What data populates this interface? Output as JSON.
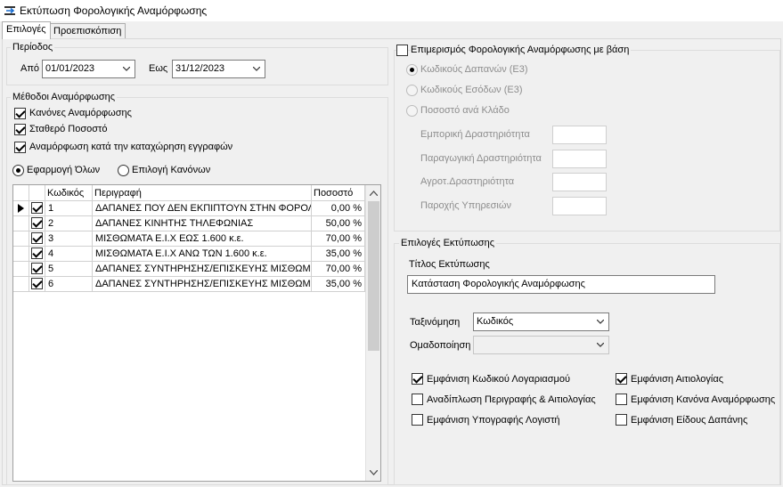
{
  "window": {
    "title": "Εκτύπωση Φορολογικής Αναμόρφωσης"
  },
  "tabs": [
    {
      "label": "Επιλογές"
    },
    {
      "label": "Προεπισκόπιση"
    }
  ],
  "period": {
    "label": "Περίοδος",
    "from_label": "Από",
    "from_value": "01/01/2023",
    "to_label": "Εως",
    "to_value": "31/12/2023"
  },
  "methods": {
    "label": "Μέθοδοι Αναμόρφωσης",
    "checkboxes": [
      {
        "label": "Κανόνες Αναμόρφωσης",
        "checked": true
      },
      {
        "label": "Σταθερό Ποσοστό",
        "checked": true
      },
      {
        "label": "Αναμόρφωση κατά την καταχώρηση εγγραφών",
        "checked": true
      }
    ],
    "radios": [
      {
        "label": "Εφαρμογή Όλων",
        "checked": true
      },
      {
        "label": "Επιλογή Κανόνων",
        "checked": false
      }
    ]
  },
  "grid": {
    "columns": [
      "Κωδικός",
      "Περιγραφή",
      "Ποσοστό"
    ],
    "rows": [
      {
        "code": "1",
        "description": "ΔΑΠΑΝΕΣ ΠΟΥ ΔΕΝ ΕΚΠΙΠΤΟΥΝ ΣΤΗΝ ΦΟΡΟΛΟΓΙ",
        "percent": "0,00 %",
        "checked": true,
        "current": true
      },
      {
        "code": "2",
        "description": "ΔΑΠΑΝΕΣ ΚΙΝΗΤΗΣ ΤΗΛΕΦΩΝΙΑΣ",
        "percent": "50,00 %",
        "checked": true,
        "current": false
      },
      {
        "code": "3",
        "description": "ΜΙΣΘΩΜΑΤΑ Ε.Ι.Χ ΕΩΣ 1.600 κ.ε.",
        "percent": "70,00 %",
        "checked": true,
        "current": false
      },
      {
        "code": "4",
        "description": "ΜΙΣΘΩΜΑΤΑ Ε.Ι.Χ ΑΝΩ ΤΩΝ 1.600 κ.ε.",
        "percent": "35,00 %",
        "checked": true,
        "current": false
      },
      {
        "code": "5",
        "description": "ΔΑΠΑΝΕΣ ΣΥΝΤΗΡΗΣΗΣ/ΕΠΙΣΚΕΥΗΣ ΜΙΣΘΩΜΕΝΩΝ",
        "percent": "70,00 %",
        "checked": true,
        "current": false
      },
      {
        "code": "6",
        "description": "ΔΑΠΑΝΕΣ ΣΥΝΤΗΡΗΣΗΣ/ΕΠΙΣΚΕΥΗΣ ΜΙΣΘΩΜΕΝΩΝ",
        "percent": "35,00 %",
        "checked": true,
        "current": false
      }
    ]
  },
  "distribution": {
    "label": "Επιμερισμός Φορολογικής  Αναμόρφωσης με βάση",
    "checked": false,
    "radios": [
      {
        "label": "Κωδικούς Δαπανών (Ε3)",
        "checked": true
      },
      {
        "label": "Κωδικούς Εσόδων (Ε3)",
        "checked": false
      },
      {
        "label": "Ποσοστό ανά Κλάδο",
        "checked": false
      }
    ],
    "fields": [
      {
        "label": "Εμπορική Δραστηριότητα",
        "value": ""
      },
      {
        "label": "Παραγωγική Δραστηριότητα",
        "value": ""
      },
      {
        "label": "Αγροτ.Δραστηριότητα",
        "value": ""
      },
      {
        "label": "Παροχής Υπηρεσιών",
        "value": ""
      }
    ]
  },
  "print_options": {
    "label": "Επιλογές Εκτύπωσης",
    "title_label": "Τίτλος Εκτύπωσης",
    "title_value": "Κατάσταση Φορολογικής Αναμόρφωσης",
    "sort_label": "Ταξινόμηση",
    "sort_value": "Κωδικός",
    "group_label": "Ομαδοποίηση",
    "group_value": "",
    "checkboxes": [
      {
        "label": "Εμφάνιση Κωδικού Λογαριασμού",
        "checked": true
      },
      {
        "label": "Εμφάνιση Αιτιολογίας",
        "checked": true
      },
      {
        "label": "Αναδίπλωση Περιγραφής & Αιτιολογίας",
        "checked": false
      },
      {
        "label": "Εμφάνιση Κανόνα Αναμόρφωσης",
        "checked": false
      },
      {
        "label": "Εμφάνιση Υπογραφής Λογιστή",
        "checked": false
      },
      {
        "label": "Εμφάνιση Είδους Δαπάνης",
        "checked": false
      }
    ]
  }
}
